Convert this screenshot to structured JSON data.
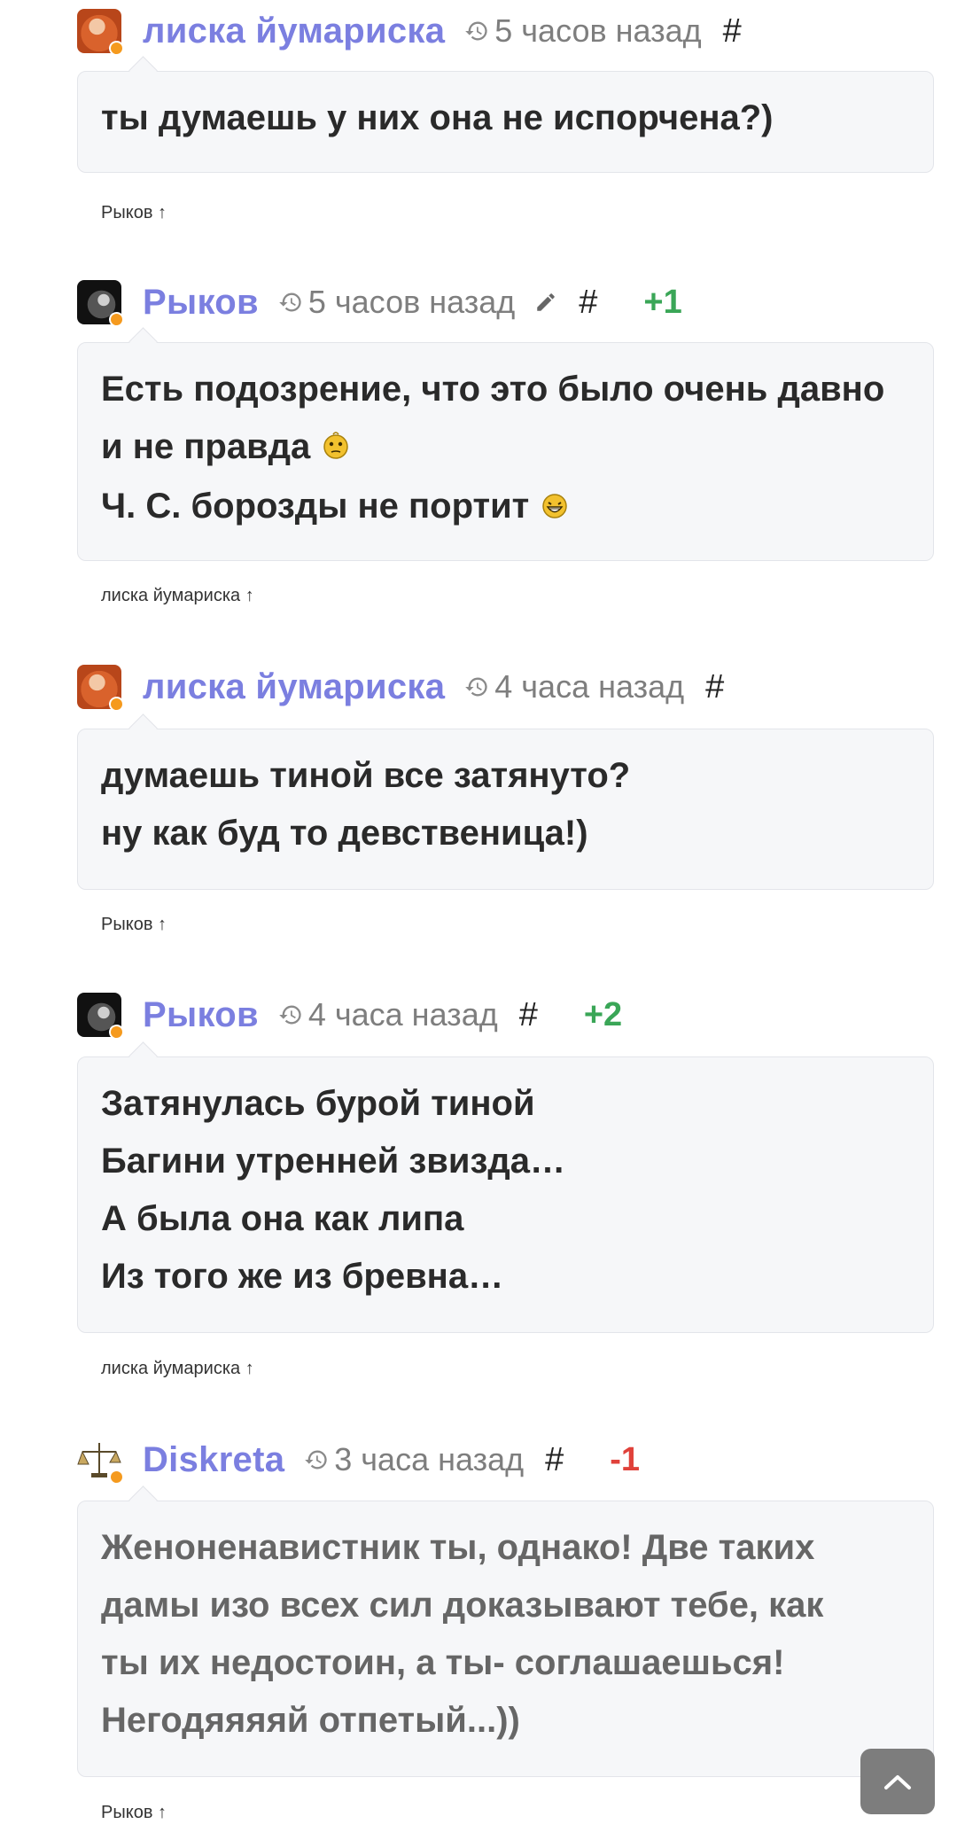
{
  "comments": [
    {
      "author": "лиска йумариска",
      "avatar_icon": "redhead-avatar-icon",
      "time": "5 часов назад",
      "anchor": "#",
      "edited": false,
      "rating": "",
      "lines": [
        "ты думаешь у них она не испорчена?)"
      ],
      "parent_link": "Рыков ↑"
    },
    {
      "author": "Рыков",
      "avatar_icon": "bw-portrait-avatar-icon",
      "time": "5 часов назад",
      "anchor": "#",
      "edited": true,
      "rating": "+1",
      "lines": [
        "Есть подозрение, что это было очень давно",
        "и не правда",
        "Ч. С. борозды не портит"
      ],
      "smileys": [
        "thinking-smiley-icon",
        "grin-smiley-icon"
      ],
      "parent_link": "лиска йумариска ↑"
    },
    {
      "author": "лиска йумариска",
      "avatar_icon": "redhead-avatar-icon",
      "time": "4 часа назад",
      "anchor": "#",
      "edited": false,
      "rating": "",
      "lines": [
        "думаешь тиной все затянуто?",
        "ну как буд то девственица!)"
      ],
      "parent_link": "Рыков ↑"
    },
    {
      "author": "Рыков",
      "avatar_icon": "bw-portrait-avatar-icon",
      "time": "4 часа назад",
      "anchor": "#",
      "edited": false,
      "rating": "+2",
      "lines": [
        "Затянулась бурой тиной",
        "Багини утренней звизда…",
        "А была она как липа",
        "Из того же из бревна…"
      ],
      "parent_link": "лиска йумариска ↑"
    },
    {
      "author": "Diskreta",
      "avatar_icon": "scales-avatar-icon",
      "time": "3 часа назад",
      "anchor": "#",
      "edited": false,
      "rating": "-1",
      "lines": [
        "Женоненавистник ты, однако! Две таких",
        "дамы изо всех сил доказывают тебе, как",
        "ты их недостоин, а ты- соглашаешься!",
        "Негодяяяяй отпетый...))"
      ],
      "parent_link": "Рыков ↑"
    }
  ],
  "scroll_top_icon": "chevron-up-icon",
  "colors": {
    "author": "#7b7fe0",
    "rating_positive": "#3aa657",
    "rating_negative": "#e0413a",
    "online_dot": "#f59a1e",
    "bubble_bg": "#f6f7f9"
  }
}
